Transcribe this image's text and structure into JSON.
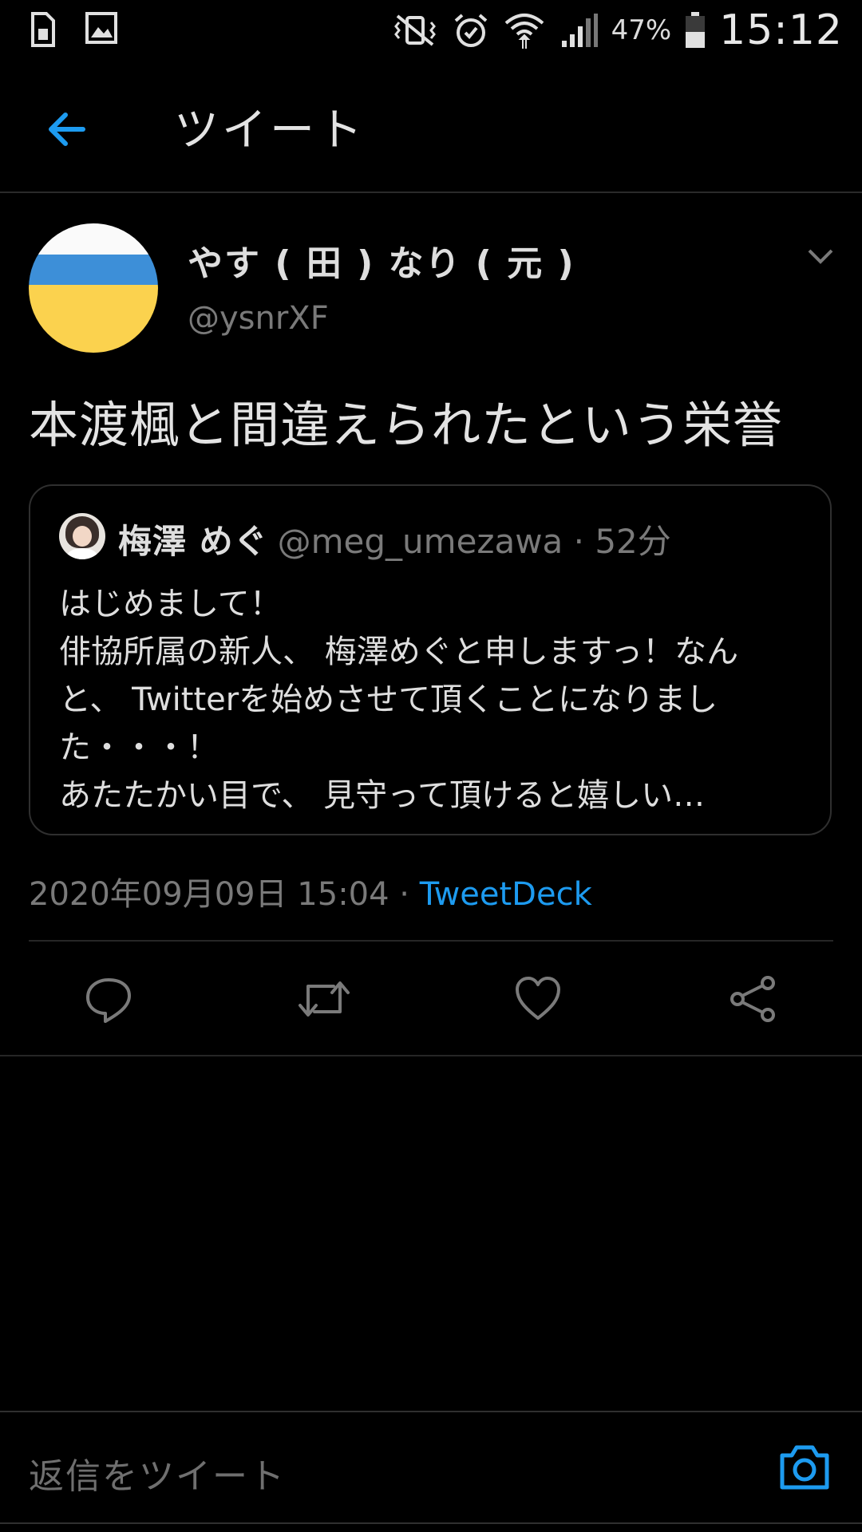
{
  "status_bar": {
    "battery_percent": "47%",
    "time": "15:12"
  },
  "appbar": {
    "title": "ツイート"
  },
  "tweet": {
    "display_name": "やす ( 田 ) なり ( 元 )",
    "handle": "@ysnrXF",
    "text": "本渡楓と間違えられたという栄誉",
    "timestamp": "2020年09月09日 15:04",
    "separator": " · ",
    "source": "TweetDeck"
  },
  "quoted": {
    "name": "梅澤 めぐ",
    "handle": "@meg_umezawa · 52分",
    "lines": [
      "はじめまして！",
      "俳協所属の新人、 梅澤めぐと申しますっ！なん",
      "と、 Twitterを始めさせて頂くことになりまし",
      "た・・・！",
      "あたたかい目で、 見守って頂けると嬉しい…"
    ]
  },
  "reply": {
    "placeholder": "返信をツイート"
  },
  "colors": {
    "accent": "#1d9bf0",
    "background": "#000000",
    "muted": "#7a7a7a"
  },
  "icons": [
    "sim-icon",
    "gallery-icon",
    "vibrate-mute-icon",
    "alarm-icon",
    "wifi-icon",
    "signal-icon",
    "battery-icon",
    "back-arrow-icon",
    "chevron-down-icon",
    "reply-icon",
    "retweet-icon",
    "like-icon",
    "share-icon",
    "camera-icon"
  ]
}
